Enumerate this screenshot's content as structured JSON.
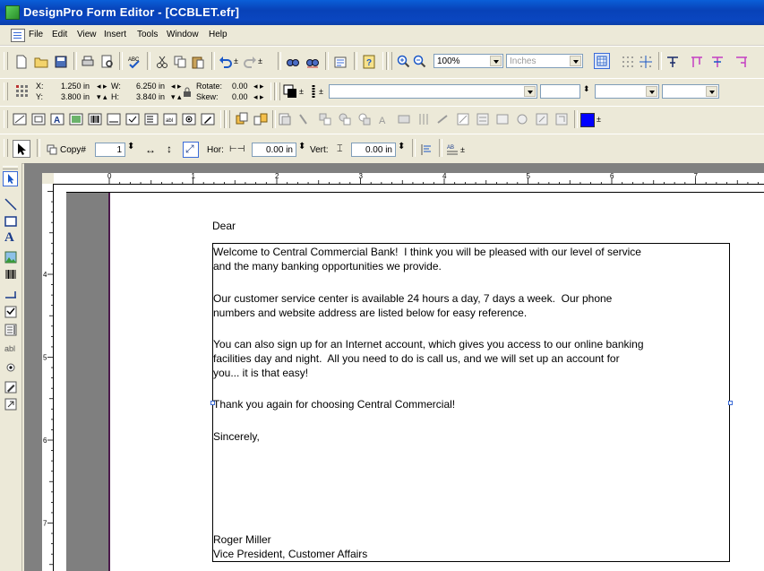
{
  "window": {
    "title": "DesignPro Form Editor  - [CCBLET.efr]"
  },
  "menu": [
    "File",
    "Edit",
    "View",
    "Insert",
    "Tools",
    "Window",
    "Help"
  ],
  "toolbar1": {
    "zoom": "100%",
    "units_placeholder": "Inches"
  },
  "position": {
    "x_label": "X:",
    "x_value": "1.250 in",
    "y_label": "Y:",
    "y_value": "3.800 in",
    "w_label": "W:",
    "w_value": "6.250 in",
    "h_label": "H:",
    "h_value": "3.840 in",
    "rotate_label": "Rotate:",
    "rotate_value": "0.00",
    "skew_label": "Skew:",
    "skew_value": "0.00"
  },
  "toolbar4": {
    "copy_label": "Copy#",
    "copy_value": "1",
    "hor_label": "Hor:",
    "hor_value": "0.00 in",
    "vert_label": "Vert:",
    "vert_value": "0.00 in"
  },
  "ruler": {
    "h_numbers": [
      "0",
      "1",
      "2",
      "3",
      "4",
      "5",
      "6",
      "7"
    ],
    "v_numbers": [
      "4",
      "5",
      "6",
      "7"
    ]
  },
  "letter": {
    "salutation": "Dear",
    "p1_l1": "Welcome to Central Commercial Bank!  I think you will be pleased with our level of service",
    "p1_l2": "and the many banking opportunities we provide.",
    "p2_l1": "Our customer service center is available 24 hours a day, 7 days a week.  Our phone",
    "p2_l2": "numbers and website address are listed below for easy reference.",
    "p3_l1": "You can also sign up for an Internet account, which gives you access to our online banking",
    "p3_l2": "facilities day and night.  All you need to do is call us, and we will set up an account for",
    "p3_l3": "you... it is that easy!",
    "p4": "Thank you again for choosing Central Commercial!",
    "closing": "Sincerely,",
    "signer_name": "Roger Miller",
    "signer_title": "Vice President, Customer Affairs"
  },
  "colors": {
    "fill_color": "#0000ff",
    "title_bar": "#0a4ec8"
  }
}
